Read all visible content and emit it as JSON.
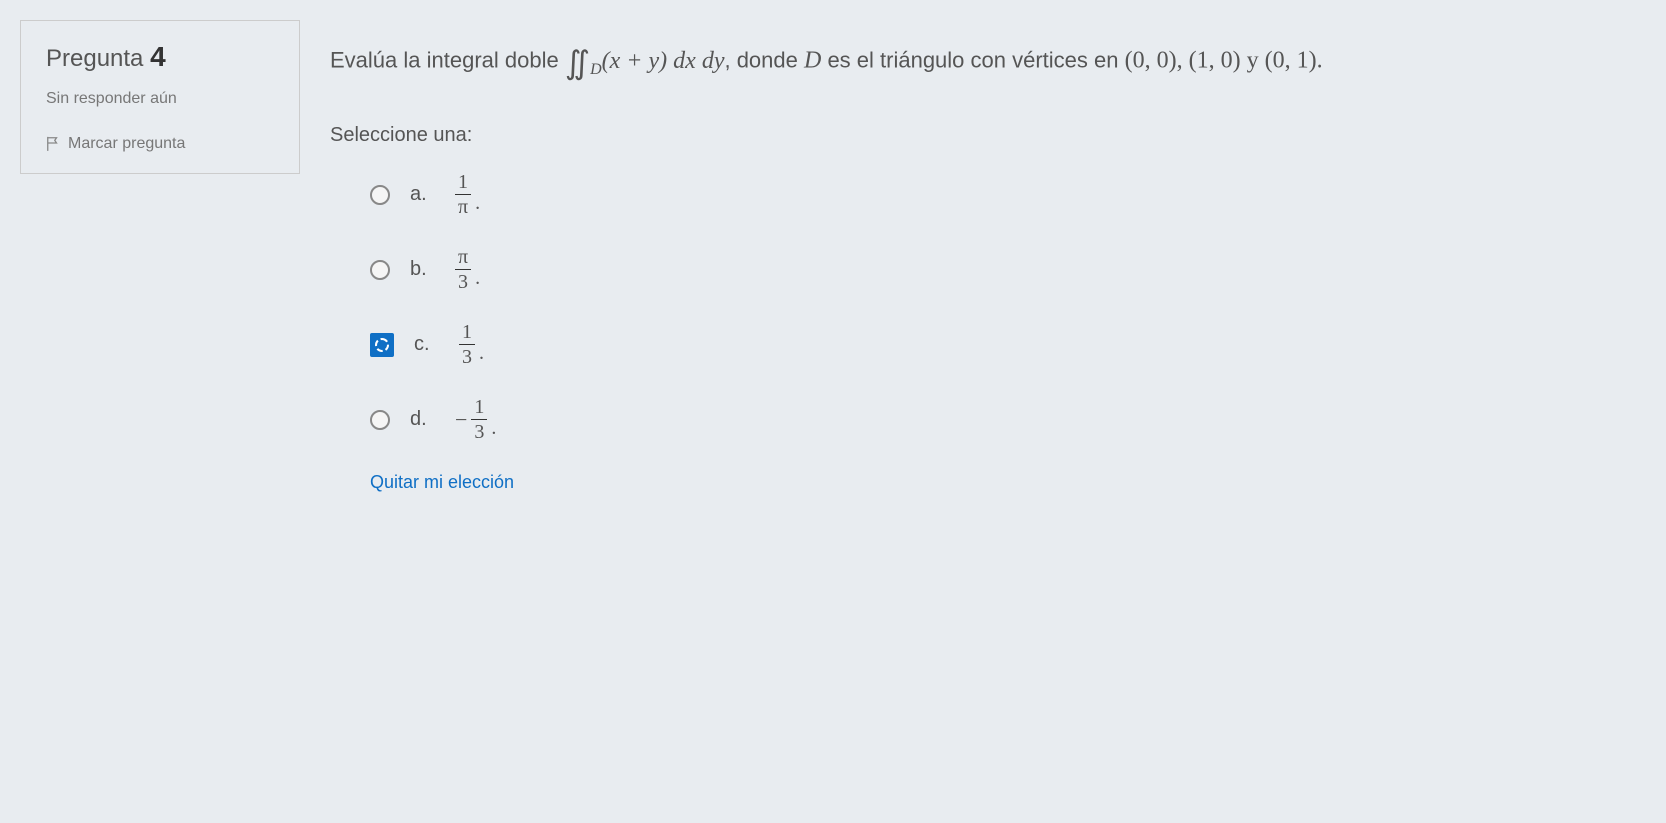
{
  "sidebar": {
    "title_prefix": "Pregunta",
    "number": "4",
    "status": "Sin responder aún",
    "flag_label": "Marcar pregunta"
  },
  "question": {
    "text_prefix": "Evalúa la integral doble ",
    "integral_sub": "D",
    "integrand": "(x + y) dx dy",
    "text_mid": ", donde ",
    "d_var": "D",
    "text_after_d": " es el triángulo con vértices en ",
    "vertices": "(0, 0), (1, 0) y (0, 1).",
    "select_label": "Seleccione una:"
  },
  "options": {
    "a": {
      "label": "a.",
      "num": "1",
      "den": "π"
    },
    "b": {
      "label": "b.",
      "num": "π",
      "den": "3"
    },
    "c": {
      "label": "c.",
      "num": "1",
      "den": "3",
      "selected": true
    },
    "d": {
      "label": "d.",
      "neg": "−",
      "num": "1",
      "den": "3"
    }
  },
  "clear_choice": "Quitar mi elección"
}
